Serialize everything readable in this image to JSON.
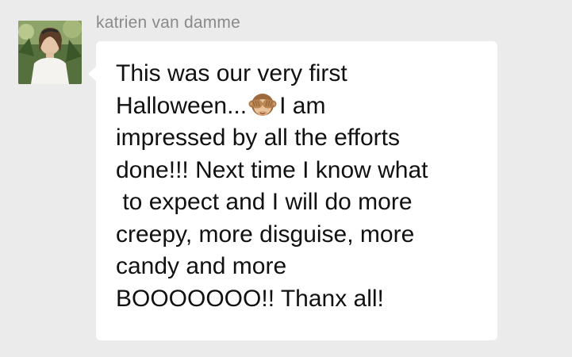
{
  "sender": {
    "name": "katrien van damme",
    "avatar_icon": "profile-photo-icon"
  },
  "message": {
    "lines": [
      "This was our very first",
      "Halloween...",
      "I am",
      "impressed by all the efforts",
      "done!!! Next time I know what",
      " to expect and I will do more",
      "creepy, more disguise, more",
      "candy and more",
      "BOOOOOOO!! Thanx all!"
    ],
    "emoji_icon": "see-no-evil-monkey-icon"
  },
  "colors": {
    "background": "#ebebeb",
    "bubble": "#ffffff",
    "name_text": "#8a8a8a",
    "message_text": "#111111"
  }
}
